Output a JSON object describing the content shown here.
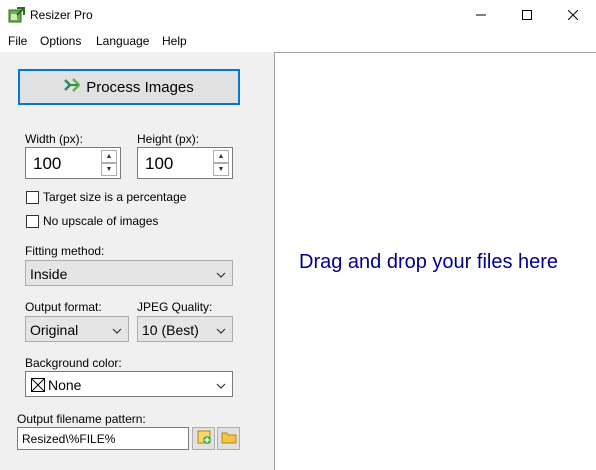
{
  "window": {
    "title": "Resizer Pro",
    "icon": "resize-app-icon"
  },
  "menu": [
    "File",
    "Options",
    "Language",
    "Help"
  ],
  "left": {
    "process_button": "Process Images",
    "width_label": "Width (px):",
    "width_value": "100",
    "height_label": "Height (px):",
    "height_value": "100",
    "target_percentage_label": "Target size is a percentage",
    "target_percentage_checked": false,
    "no_upscale_label": "No upscale of images",
    "no_upscale_checked": false,
    "fitting_label": "Fitting method:",
    "fitting_value": "Inside",
    "output_format_label": "Output format:",
    "output_format_value": "Original",
    "jpeg_quality_label": "JPEG Quality:",
    "jpeg_quality_value": "10 (Best)",
    "background_label": "Background color:",
    "background_value": "None",
    "filename_label": "Output filename pattern:",
    "filename_value": "Resized\\%FILE%"
  },
  "right": {
    "drop_text": "Drag and drop your files here"
  },
  "colors": {
    "accent": "#0078d7",
    "drop_text": "#00008b",
    "panel_bg": "#f0f0f0"
  }
}
